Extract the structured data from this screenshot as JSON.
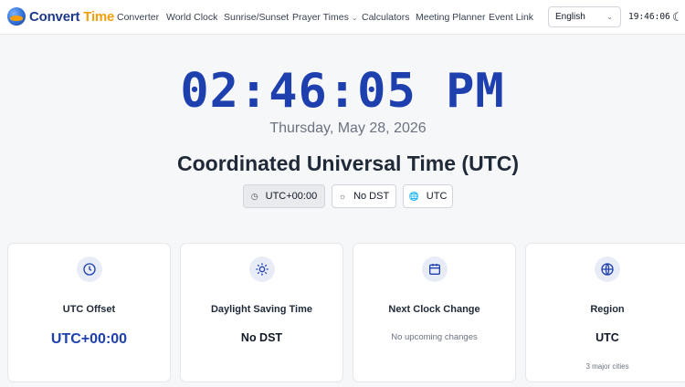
{
  "header": {
    "logo_part1": "Convert",
    "logo_part2": "Time",
    "nav": [
      "Converter",
      "World Clock",
      "Sunrise/Sunset",
      "Prayer Times",
      "Calculators",
      "Meeting Planner",
      "Event Link"
    ],
    "language": "English",
    "clock": "19:46:06"
  },
  "hero": {
    "time": "02:46:05 PM",
    "date": "Thursday, May 28, 2026",
    "zone": "Coordinated Universal Time (UTC)",
    "badges": [
      "UTC+00:00",
      "No DST",
      "UTC"
    ]
  },
  "cards": [
    {
      "title": "UTC Offset",
      "value": "UTC+00:00"
    },
    {
      "title": "Daylight Saving Time",
      "value": "No DST"
    },
    {
      "title": "Next Clock Change",
      "value": "No upcoming changes"
    },
    {
      "title": "Region",
      "value": "UTC",
      "footnote": "3 major cities"
    }
  ],
  "icons": {
    "logo": "globe-logo-icon",
    "prayer_times": "chevron-down-icon",
    "language": "chevron-down-icon",
    "theme": "moon-icon",
    "badges": [
      "clock-icon",
      "sun-icon",
      "globe-icon"
    ],
    "cards": [
      "clock-icon",
      "sun-icon",
      "calendar-icon",
      "globe-icon"
    ]
  },
  "colors": {
    "brand_blue": "#1e40af",
    "brand_orange": "#f59e0b",
    "icon_bg": "#e8ecf7"
  }
}
